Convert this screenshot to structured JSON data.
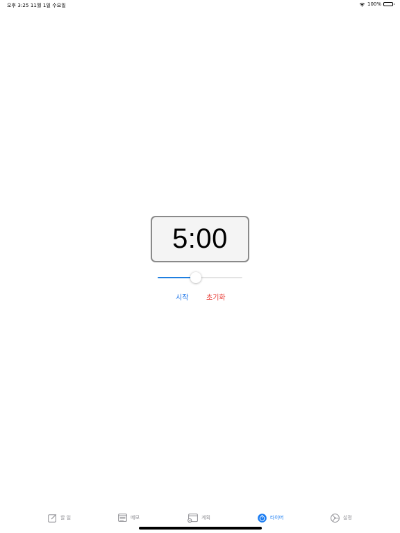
{
  "status_bar": {
    "time_date": "오후 3:25   11월 1일 수요일",
    "battery": "100%"
  },
  "timer": {
    "display": "5:00"
  },
  "slider": {
    "value_fraction": 0.45
  },
  "actions": {
    "start_label": "시작",
    "reset_label": "초기화"
  },
  "tabs": [
    {
      "label": "할 일",
      "icon": "compose-icon",
      "active": false
    },
    {
      "label": "메모",
      "icon": "notes-icon",
      "active": false
    },
    {
      "label": "계획",
      "icon": "calendar-check-icon",
      "active": false
    },
    {
      "label": "타이머",
      "icon": "timer-icon",
      "active": true
    },
    {
      "label": "설정",
      "icon": "settings-icon",
      "active": false
    }
  ],
  "colors": {
    "accent": "#1a7cf2",
    "reset": "#e8403a",
    "inactive_tab": "#8e8e93"
  }
}
